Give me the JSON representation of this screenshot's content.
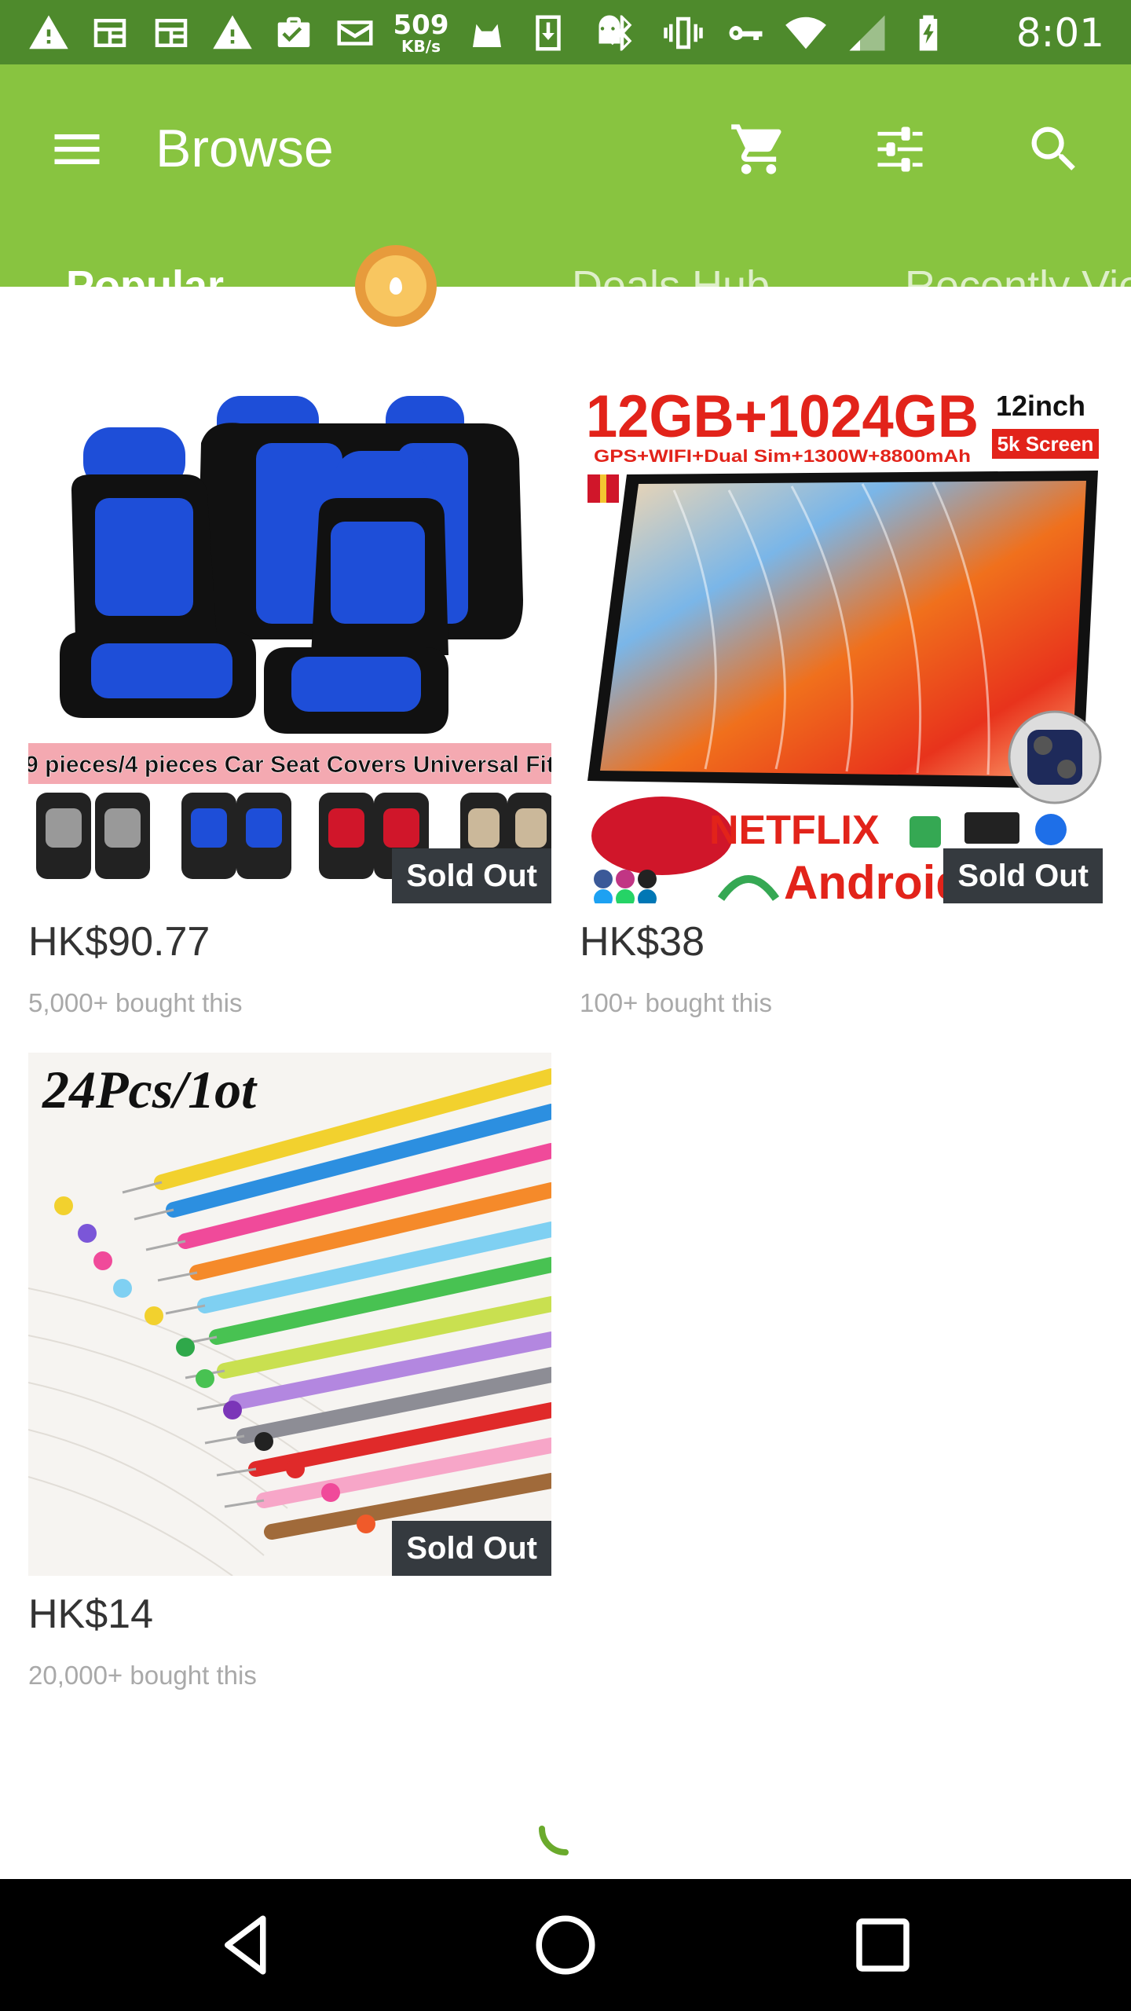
{
  "status_bar": {
    "net_speed_value": "509",
    "net_speed_unit": "KB/s",
    "time": "8:01"
  },
  "app_bar": {
    "title": "Browse"
  },
  "tabs": [
    {
      "label": "Popular",
      "active": true
    },
    {
      "label": "",
      "active": false,
      "icon": "coin-icon"
    },
    {
      "label": "Deals Hub",
      "active": false
    },
    {
      "label": "Recently Vie",
      "active": false
    }
  ],
  "products": [
    {
      "price": "HK$90.77",
      "bought": "5,000+ bought this",
      "badge": "Sold Out",
      "image_caption": "9 pieces/4 pieces Car Seat Covers Universal Fit"
    },
    {
      "price": "HK$38",
      "bought": "100+ bought this",
      "badge": "Sold Out",
      "image_headline": "12GB+1024GB",
      "image_size": "12inch",
      "image_screen": "5k Screen",
      "image_specs": "GPS+WIFI+Dual Sim+1300W+8800mAh",
      "image_brand": "NETFLIX",
      "image_os": "Android"
    },
    {
      "price": "HK$14",
      "bought": "20,000+ bought this",
      "badge": "Sold Out",
      "image_caption": "24Pcs/1ot"
    }
  ],
  "colors": {
    "status_bar": "#4e8a2c",
    "app_bar": "#88c440",
    "badge": "#353a3f",
    "spinner": "#6aaa2c"
  }
}
